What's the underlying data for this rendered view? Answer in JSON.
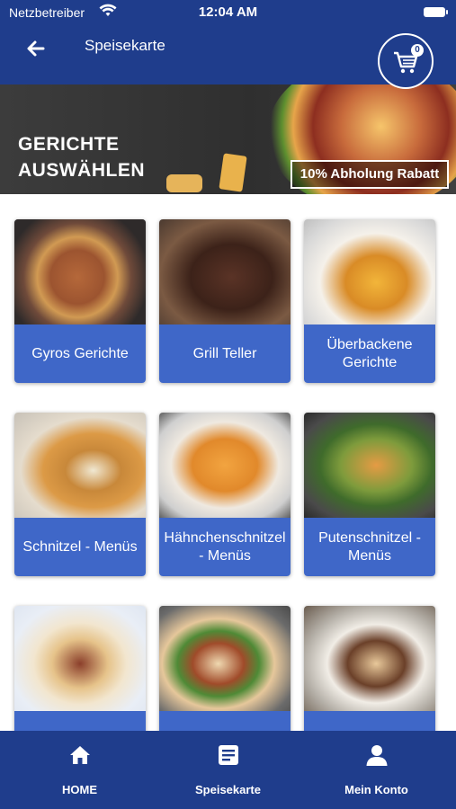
{
  "status_bar": {
    "carrier": "Netzbetreiber",
    "time": "12:04 AM"
  },
  "header": {
    "title": "Speisekarte",
    "cart_count": "0"
  },
  "banner": {
    "heading_line1": "GERICHTE",
    "heading_line2": "AUSWÄHLEN",
    "badge": "10% Abholung Rabatt"
  },
  "categories": [
    {
      "label": "Gyros Gerichte"
    },
    {
      "label": "Grill Teller"
    },
    {
      "label": "Überbackene Gerichte"
    },
    {
      "label": "Schnitzel - Menüs"
    },
    {
      "label": "Hähnchenschnitzel - Menüs"
    },
    {
      "label": "Putenschnitzel - Menüs"
    },
    {
      "label": ""
    },
    {
      "label": ""
    },
    {
      "label": ""
    }
  ],
  "tabbar": {
    "home": "HOME",
    "menu": "Speisekarte",
    "account": "Mein Konto"
  },
  "colors": {
    "primary": "#1f3d8c",
    "card_label": "#3f67c8"
  }
}
